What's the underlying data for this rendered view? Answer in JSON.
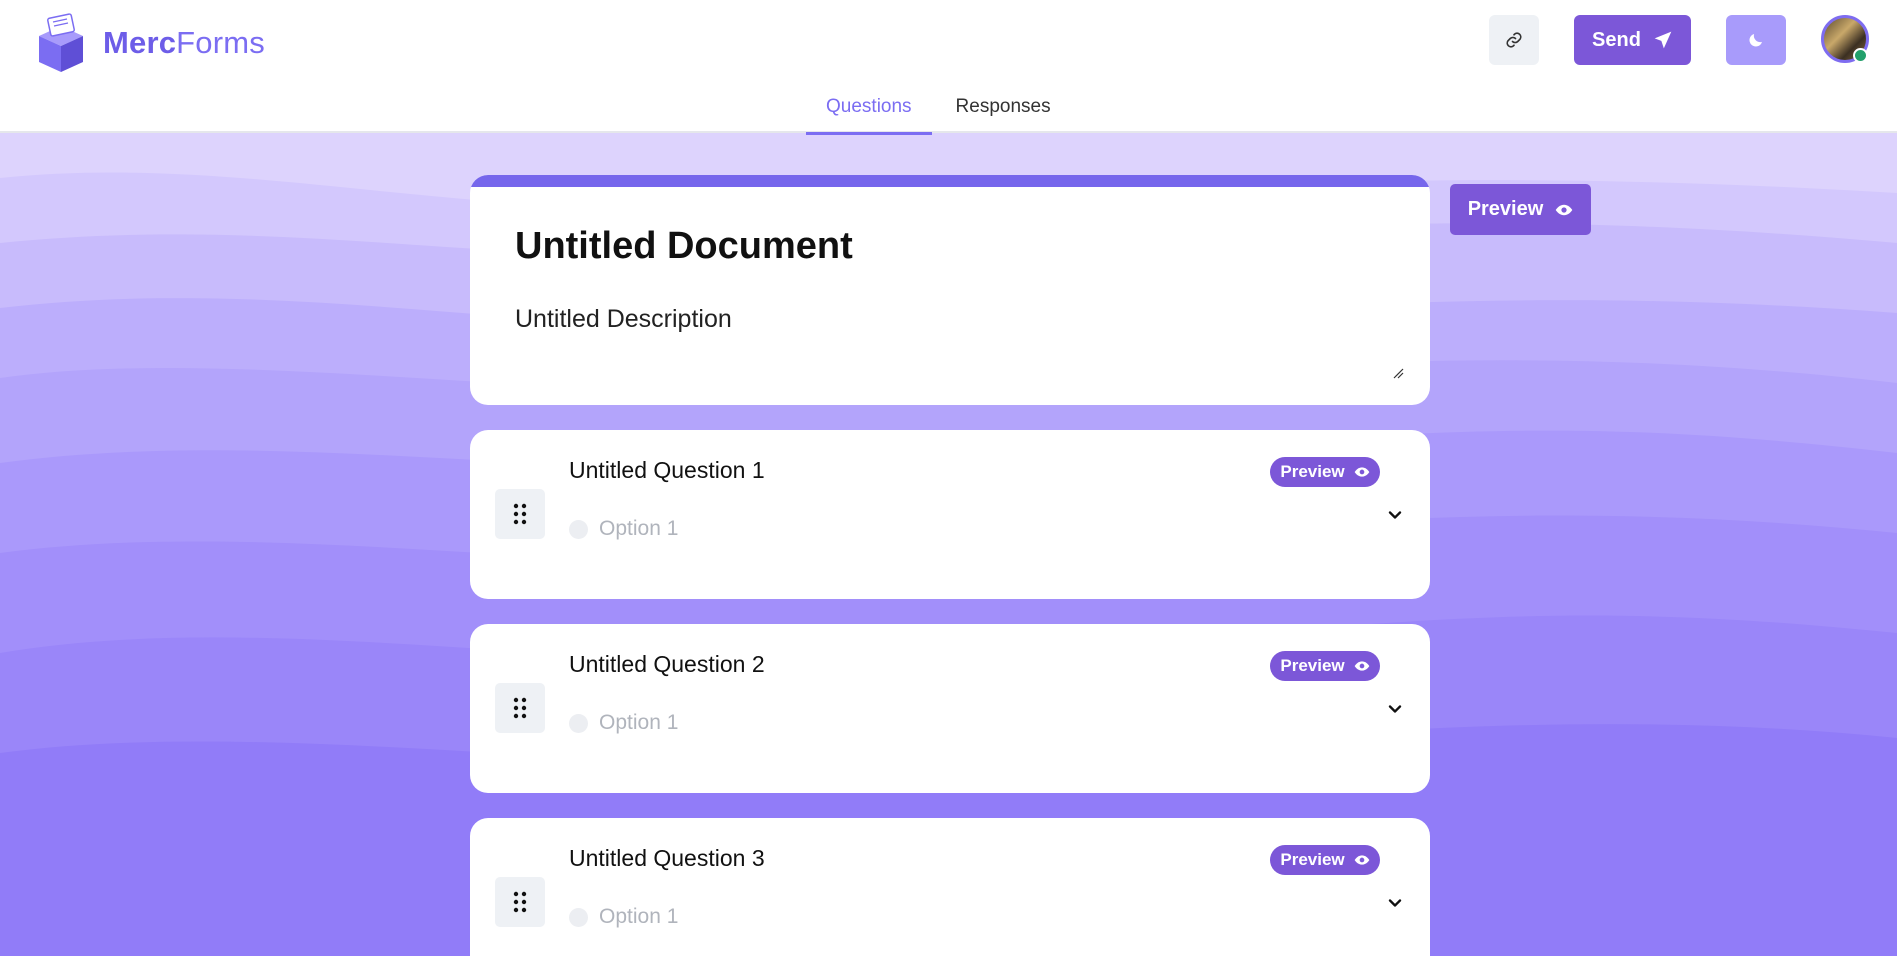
{
  "brand": {
    "bold": "Merc",
    "rest": "Forms",
    "logo_icon": "box-logo-icon"
  },
  "header": {
    "link_icon": "link-icon",
    "send_label": "Send",
    "send_icon": "paper-plane-icon",
    "theme_icon": "moon-icon",
    "avatar": "user-avatar",
    "status": "online"
  },
  "tabs": [
    {
      "label": "Questions",
      "active": true
    },
    {
      "label": "Responses",
      "active": false
    }
  ],
  "document": {
    "title": "Untitled Document",
    "description": "Untitled Description"
  },
  "side_preview_label": "Preview",
  "questions": [
    {
      "title": "Untitled Question 1",
      "option": "Option 1",
      "preview_label": "Preview"
    },
    {
      "title": "Untitled Question 2",
      "option": "Option 1",
      "preview_label": "Preview"
    },
    {
      "title": "Untitled Question 3",
      "option": "Option 1",
      "preview_label": "Preview"
    }
  ],
  "colors": {
    "accent": "#7c57d8",
    "brand": "#7b6df2",
    "background_light": "#ddd3fd",
    "background_dark": "#8f7af9"
  }
}
